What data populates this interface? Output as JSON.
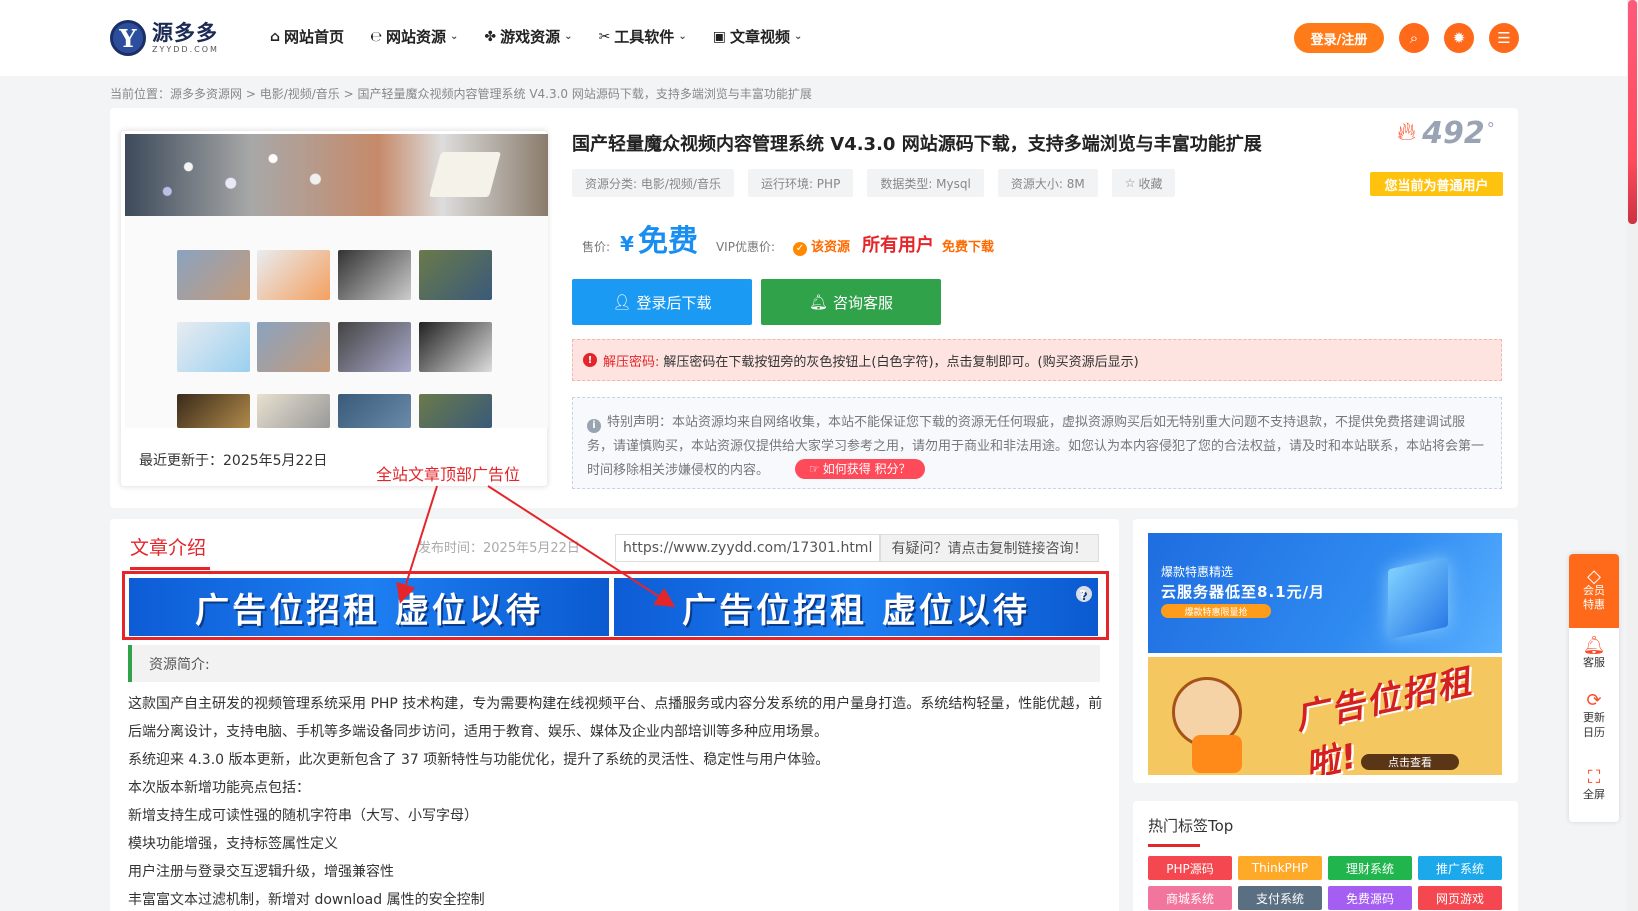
{
  "header": {
    "logo": {
      "name": "源多多",
      "sub": "ZYYDD.COM",
      "mark": "Y"
    },
    "nav": [
      {
        "label": "网站首页",
        "icon": "home-icon",
        "has_menu": false
      },
      {
        "label": "网站资源",
        "icon": "ie-icon",
        "has_menu": true
      },
      {
        "label": "游戏资源",
        "icon": "gamepad-icon",
        "has_menu": true
      },
      {
        "label": "工具软件",
        "icon": "tools-icon",
        "has_menu": true
      },
      {
        "label": "文章视频",
        "icon": "camera-icon",
        "has_menu": true
      }
    ],
    "login_label": "登录/注册",
    "icons": [
      "search-icon",
      "gear-icon",
      "list-icon"
    ]
  },
  "breadcrumb": {
    "prefix": "当前位置：",
    "items": [
      "源多多资源网",
      "电影/视频/音乐",
      "国产轻量魔众视频内容管理系统 V4.3.0 网站源码下载，支持多端浏览与丰富功能扩展"
    ],
    "sep": " > "
  },
  "product": {
    "title": "国产轻量魔众视频内容管理系统 V4.3.0 网站源码下载，支持多端浏览与丰富功能扩展",
    "views": "492",
    "views_unit": "°",
    "tags": [
      "资源分类: 电影/视频/音乐",
      "运行环境: PHP",
      "数据类型: Mysql",
      "资源大小: 8M",
      "收藏"
    ],
    "user_status": "您当前为普通用户",
    "price_label": "售价:",
    "currency": "¥",
    "price": "免费",
    "vip_label": "VIP优惠价:",
    "res_label": "该资源",
    "all_users": "所有用户",
    "free_dl": "免费下载",
    "download_btn": "登录后下载",
    "consult_btn": "咨询客服",
    "password_key": "解压密码:",
    "password_text": "解压密码在下载按钮旁的灰色按钮上(白色字符)，点击复制即可。(购买资源后显示)",
    "notice_text": "特别声明：本站资源均来自网络收集，本站不能保证您下载的资源无任何瑕疵，虚拟资源购买后如无特别重大问题不支持退款，不提供免费搭建调试服务，请谨慎购买，本站资源仅提供给大家学习参考之用，请勿用于商业和非法用途。如您认为本内容侵犯了您的合法权益，请及时和本站联系，本站将会第一时间移除相关涉嫌侵权的内容。",
    "points_btn": "如何获得 积分？",
    "updated": "最近更新于：2025年5月22日",
    "ad_note": "全站文章顶部广告位"
  },
  "article": {
    "section_title": "文章介绍",
    "pub_time": "发布时间：2025年5月22日",
    "url": "https://www.zyydd.com/17301.html",
    "ask": "有疑问？请点击复制链接咨询！",
    "ad_text": "广告位招租 虚位以待",
    "summary_label": "资源简介:",
    "paragraphs": [
      "这款国产自主研发的视频管理系统采用 PHP 技术构建，专为需要构建在线视频平台、点播服务或内容分发系统的用户量身打造。系统结构轻量，性能优越，前后端分离设计，支持电脑、手机等多端设备同步访问，适用于教育、娱乐、媒体及企业内部培训等多种应用场景。",
      "系统迎来 4.3.0 版本更新，此次更新包含了 37 项新特性与功能优化，提升了系统的灵活性、稳定性与用户体验。",
      "本次版本新增功能亮点包括：",
      "新增支持生成可读性强的随机字符串（大写、小写字母）",
      "模块功能增强，支持标签属性定义",
      "用户注册与登录交互逻辑升级，增强兼容性",
      "丰富富文本过滤机制，新增对 download 属性的安全控制"
    ]
  },
  "sidebar": {
    "ad1": {
      "line1": "爆款特惠精选",
      "line2": "云服务器低至8.1元/月",
      "line3": "爆款特惠限量抢"
    },
    "ad2": {
      "text": "广告位招租啦!",
      "cta": "点击查看"
    },
    "hot_title": "热门标签Top",
    "hot_tags": [
      {
        "label": "PHP源码",
        "color": "#f4474f"
      },
      {
        "label": "ThinkPHP",
        "color": "#ffa928"
      },
      {
        "label": "理财系统",
        "color": "#21b54e"
      },
      {
        "label": "推广系统",
        "color": "#1ba9ec"
      },
      {
        "label": "商城系统",
        "color": "#f2759e"
      },
      {
        "label": "支付系统",
        "color": "#5a6f82"
      },
      {
        "label": "免费源码",
        "color": "#a45ef2"
      },
      {
        "label": "网页游戏",
        "color": "#f4474f"
      }
    ]
  },
  "float_bar": {
    "vip": "会员特惠",
    "items": [
      {
        "label": "客服",
        "icon": "bell-icon"
      },
      {
        "label": "更新日历",
        "icon": "refresh-icon"
      },
      {
        "label": "全屏",
        "icon": "fullscreen-icon"
      }
    ]
  },
  "colors": {
    "accent": "#ff6a1a",
    "primary_blue": "#1a9af2",
    "green": "#2fa24a",
    "red": "#e4262a"
  }
}
